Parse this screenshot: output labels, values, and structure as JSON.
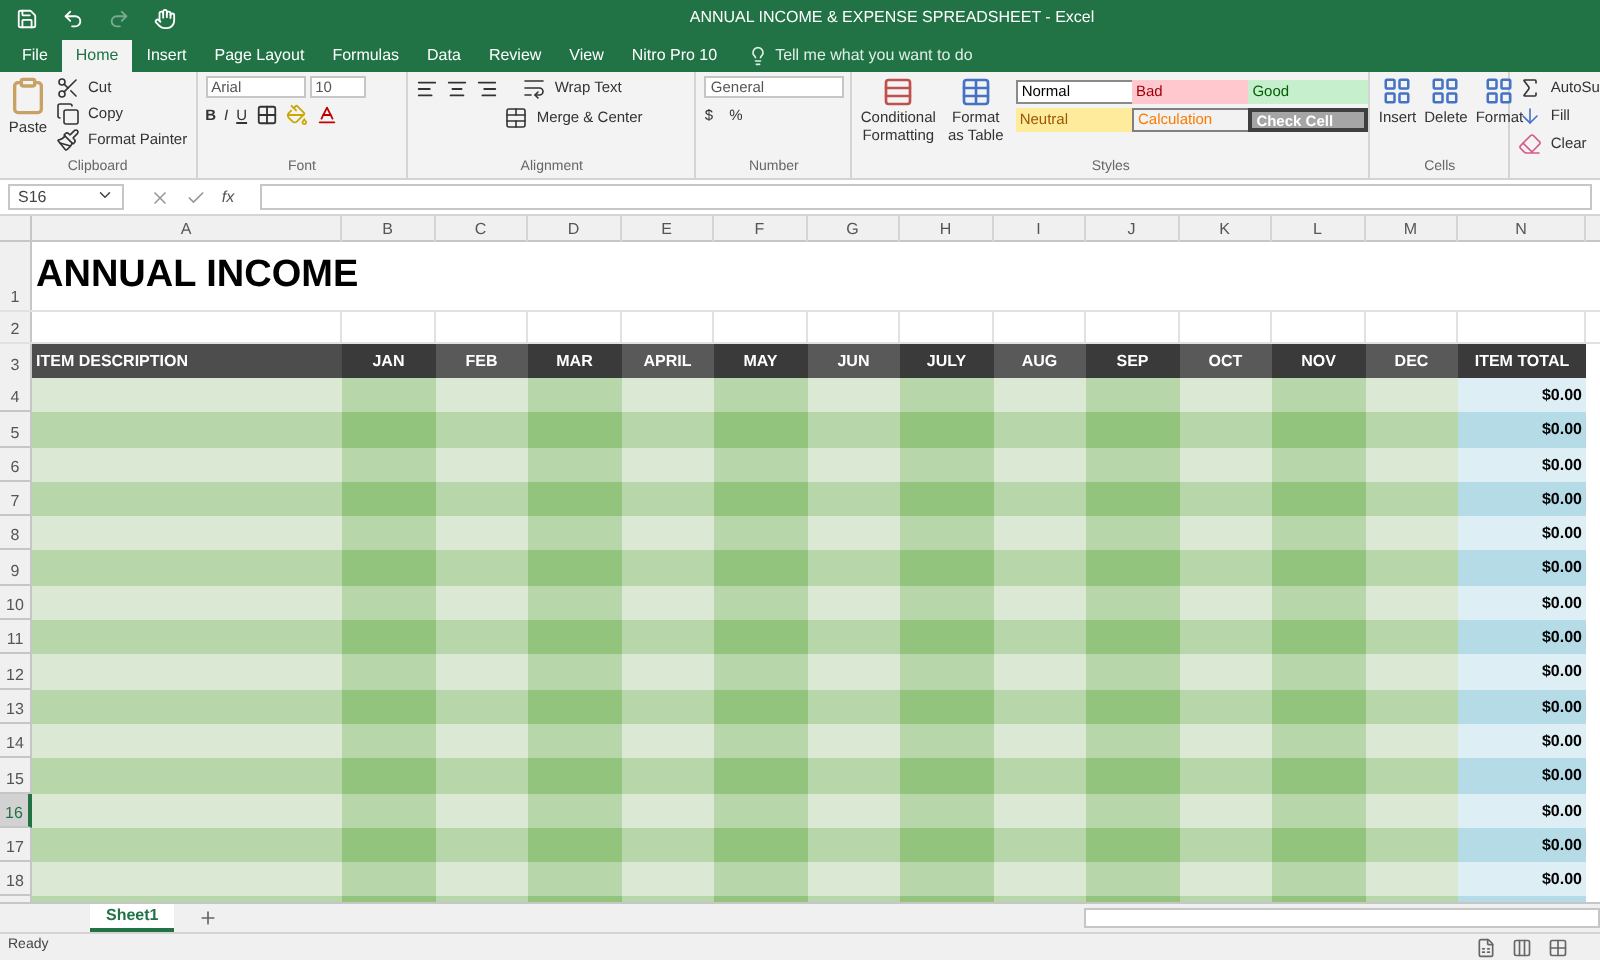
{
  "window": {
    "title": "ANNUAL INCOME & EXPENSE SPREADSHEET - Excel"
  },
  "menu_tabs": [
    {
      "label": "File",
      "selected": false
    },
    {
      "label": "Home",
      "selected": true
    },
    {
      "label": "Insert",
      "selected": false
    },
    {
      "label": "Page Layout",
      "selected": false
    },
    {
      "label": "Formulas",
      "selected": false
    },
    {
      "label": "Data",
      "selected": false
    },
    {
      "label": "Review",
      "selected": false
    },
    {
      "label": "View",
      "selected": false
    },
    {
      "label": "Nitro Pro 10",
      "selected": false
    }
  ],
  "tell_me": "Tell me what you want to do",
  "ribbon": {
    "clipboard": {
      "label": "Clipboard",
      "paste": "Paste",
      "cut": "Cut",
      "copy": "Copy",
      "format_painter": "Format Painter"
    },
    "font": {
      "label": "Font",
      "name": "Arial",
      "size": "10",
      "bold": "B",
      "italic": "I",
      "underline": "U"
    },
    "alignment": {
      "label": "Alignment",
      "wrap": "Wrap Text",
      "merge": "Merge & Center"
    },
    "number": {
      "label": "Number",
      "format": "General",
      "currency": "$",
      "percent": "%"
    },
    "styles": {
      "label": "Styles",
      "conditional": "Conditional Formatting",
      "format_table": "Format as Table",
      "cell_styles": [
        {
          "label": "Normal",
          "kind": "normal"
        },
        {
          "label": "Bad",
          "kind": "bad"
        },
        {
          "label": "Good",
          "kind": "good"
        },
        {
          "label": "Neutral",
          "kind": "neutral"
        },
        {
          "label": "Calculation",
          "kind": "calculation"
        },
        {
          "label": "Check Cell",
          "kind": "check"
        }
      ]
    },
    "cells": {
      "label": "Cells",
      "buttons": [
        "Insert",
        "Delete",
        "Format"
      ]
    },
    "editing": {
      "autosum": "AutoSu",
      "fill": "Fill",
      "clear": "Clear"
    }
  },
  "formula_bar": {
    "name_box": "S16",
    "fx": "fx"
  },
  "sheet": {
    "columns": [
      "A",
      "B",
      "C",
      "D",
      "E",
      "F",
      "G",
      "H",
      "I",
      "J",
      "K",
      "L",
      "M",
      "N"
    ],
    "title_row": {
      "number": "1",
      "text": "ANNUAL INCOME"
    },
    "blank_row": {
      "number": "2"
    },
    "header_row": {
      "number": "3",
      "cells": [
        "ITEM DESCRIPTION",
        "JAN",
        "FEB",
        "MAR",
        "APRIL",
        "MAY",
        "JUN",
        "JULY",
        "AUG",
        "SEP",
        "OCT",
        "NOV",
        "DEC",
        "ITEM TOTAL"
      ]
    },
    "rows": [
      {
        "number": "4",
        "total": "$0.00",
        "selected": false
      },
      {
        "number": "5",
        "total": "$0.00",
        "selected": false
      },
      {
        "number": "6",
        "total": "$0.00",
        "selected": false
      },
      {
        "number": "7",
        "total": "$0.00",
        "selected": false
      },
      {
        "number": "8",
        "total": "$0.00",
        "selected": false
      },
      {
        "number": "9",
        "total": "$0.00",
        "selected": false
      },
      {
        "number": "10",
        "total": "$0.00",
        "selected": false
      },
      {
        "number": "11",
        "total": "$0.00",
        "selected": false
      },
      {
        "number": "12",
        "total": "$0.00",
        "selected": false
      },
      {
        "number": "13",
        "total": "$0.00",
        "selected": false
      },
      {
        "number": "14",
        "total": "$0.00",
        "selected": false
      },
      {
        "number": "15",
        "total": "$0.00",
        "selected": false
      },
      {
        "number": "16",
        "total": "$0.00",
        "selected": true
      },
      {
        "number": "17",
        "total": "$0.00",
        "selected": false
      },
      {
        "number": "18",
        "total": "$0.00",
        "selected": false
      }
    ]
  },
  "sheet_tabs": [
    {
      "label": "Sheet1",
      "selected": true
    }
  ],
  "status_bar": {
    "text": "Ready"
  }
}
